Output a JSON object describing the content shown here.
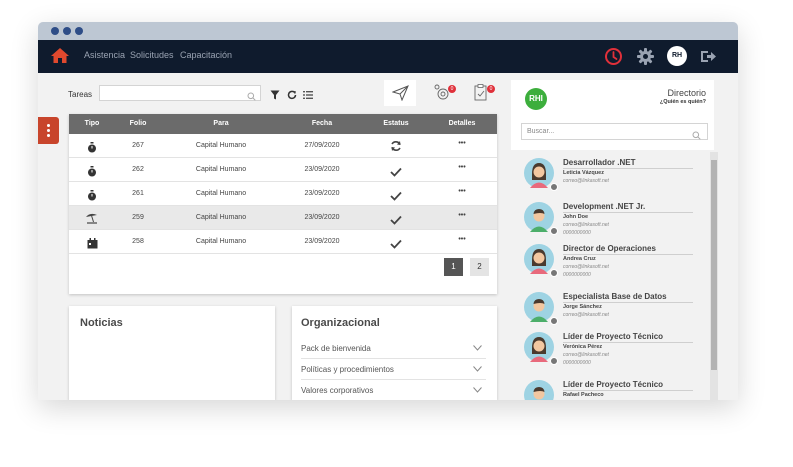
{
  "nav": {
    "links": [
      "Asistencia",
      "Solicitudes",
      "Capacitación"
    ],
    "avatar_initials": "RH",
    "icons": [
      "home-icon",
      "clock-icon",
      "gear-icon",
      "logout-icon"
    ]
  },
  "toolbar": {
    "tareas_label": "Tareas",
    "search_placeholder": "",
    "notif_count_1": "0",
    "notif_count_2": "0"
  },
  "table": {
    "headers": [
      "Tipo",
      "Folio",
      "Para",
      "Fecha",
      "Estatus",
      "Detalles"
    ],
    "rows": [
      {
        "tipo_icon": "stopwatch-icon",
        "folio": "267",
        "para": "Capital Humano",
        "fecha": "27/09/2020",
        "estatus_icon": "refresh-icon",
        "detalles": "•••"
      },
      {
        "tipo_icon": "stopwatch-icon",
        "folio": "262",
        "para": "Capital Humano",
        "fecha": "23/09/2020",
        "estatus_icon": "check-icon",
        "detalles": "•••"
      },
      {
        "tipo_icon": "stopwatch-icon",
        "folio": "261",
        "para": "Capital Humano",
        "fecha": "23/09/2020",
        "estatus_icon": "check-icon",
        "detalles": "•••"
      },
      {
        "tipo_icon": "beach-umbrella-icon",
        "folio": "259",
        "para": "Capital Humano",
        "fecha": "23/09/2020",
        "estatus_icon": "check-icon",
        "detalles": "•••"
      },
      {
        "tipo_icon": "calendar-icon",
        "folio": "258",
        "para": "Capital Humano",
        "fecha": "23/09/2020",
        "estatus_icon": "check-icon",
        "detalles": "•••"
      }
    ],
    "pages": [
      "1",
      "2"
    ],
    "active_page": "1"
  },
  "noticias": {
    "title": "Noticias"
  },
  "organizacional": {
    "title": "Organizacional",
    "items": [
      "Pack de bienvenida",
      "Políticas y procedimientos",
      "Valores corporativos"
    ]
  },
  "directory": {
    "logo_text": "RHI",
    "title": "Directorio",
    "subtitle": "¿Quién es quién?",
    "search_placeholder": "Buscar...",
    "people": [
      {
        "role": "Desarrollador .NET",
        "name": "Leticia Vázquez",
        "email": "correo@linkasoft.net",
        "phone": "",
        "avatar": "female"
      },
      {
        "role": "Development .NET Jr.",
        "name": "John Doe",
        "email": "correo@linkasoft.net",
        "phone": "0000000000",
        "avatar": "male"
      },
      {
        "role": "Director de Operaciones",
        "name": "Andrea Cruz",
        "email": "correo@linkasoft.net",
        "phone": "0000000000",
        "avatar": "female"
      },
      {
        "role": "Especialista Base de Datos",
        "name": "Jorge Sánchez",
        "email": "correo@linkasoft.net",
        "phone": "",
        "avatar": "male"
      },
      {
        "role": "Líder de Proyecto Técnico",
        "name": "Verónica Pérez",
        "email": "correo@linkasoft.net",
        "phone": "0000000000",
        "avatar": "female"
      },
      {
        "role": "Líder de Proyecto Técnico",
        "name": "Rafael Pacheco",
        "email": "",
        "phone": "",
        "avatar": "male"
      }
    ]
  },
  "colors": {
    "nav_bg": "#0f1b2d",
    "accent_red": "#c8452c",
    "badge_red": "#e0303a",
    "header_gray": "#6b6b6b",
    "window_bar": "#bdc7d3",
    "dot_blue": "#2e4d87"
  }
}
